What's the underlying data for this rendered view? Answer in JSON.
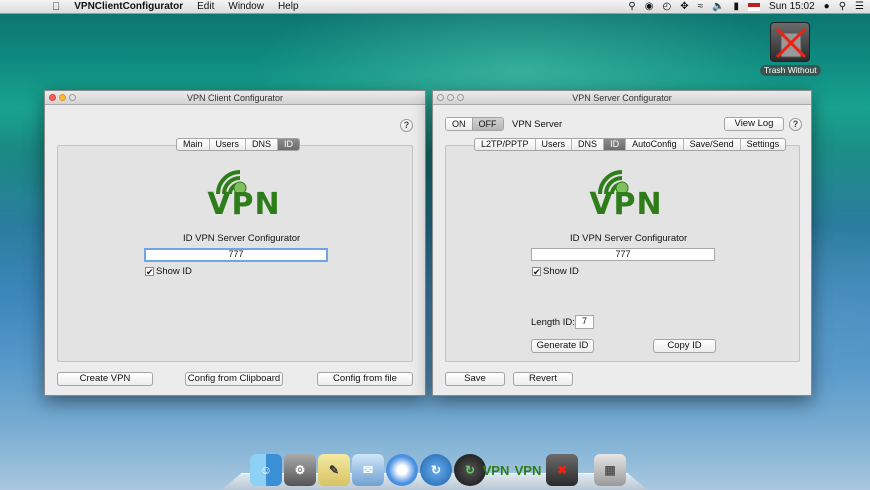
{
  "menubar": {
    "apple": "",
    "app_name": "VPNClientConfigurator",
    "menus": [
      "Edit",
      "Window",
      "Help"
    ],
    "clock": "Sun 15:02"
  },
  "desktop": {
    "trash_label": "Trash Without"
  },
  "client_window": {
    "title": "VPN Client Configurator",
    "help": "?",
    "tabs": [
      "Main",
      "Users",
      "DNS",
      "ID"
    ],
    "selected_tab": "ID",
    "logo_text": "VPN",
    "id_label": "ID VPN Server Configurator",
    "id_value": "777",
    "show_id_label": "Show ID",
    "show_id_checked": "✔",
    "buttons": {
      "create": "Create VPN",
      "from_clipboard": "Config from Clipboard",
      "from_file": "Config from file"
    }
  },
  "server_window": {
    "title": "VPN Server Configurator",
    "toggle": {
      "on": "ON",
      "off": "OFF"
    },
    "server_label": "VPN Server",
    "view_log": "View Log",
    "help": "?",
    "tabs": [
      "L2TP/PPTP",
      "Users",
      "DNS",
      "ID",
      "AutoConfig",
      "Save/Send",
      "Settings"
    ],
    "selected_tab": "ID",
    "logo_text": "VPN",
    "id_label": "ID VPN Server Configurator",
    "id_value": "777",
    "show_id_label": "Show ID",
    "show_id_checked": "✔",
    "length_label": "Length ID:",
    "length_value": "7",
    "generate_button": "Generate ID",
    "copy_button": "Copy ID",
    "save_button": "Save",
    "revert_button": "Revert"
  },
  "dock": {
    "vpn_label": "VPN"
  },
  "colors": {
    "vpn_green": "#2e7d1a",
    "selected_tab": "#6b6b6b",
    "focus_ring": "#6fa6e6"
  }
}
